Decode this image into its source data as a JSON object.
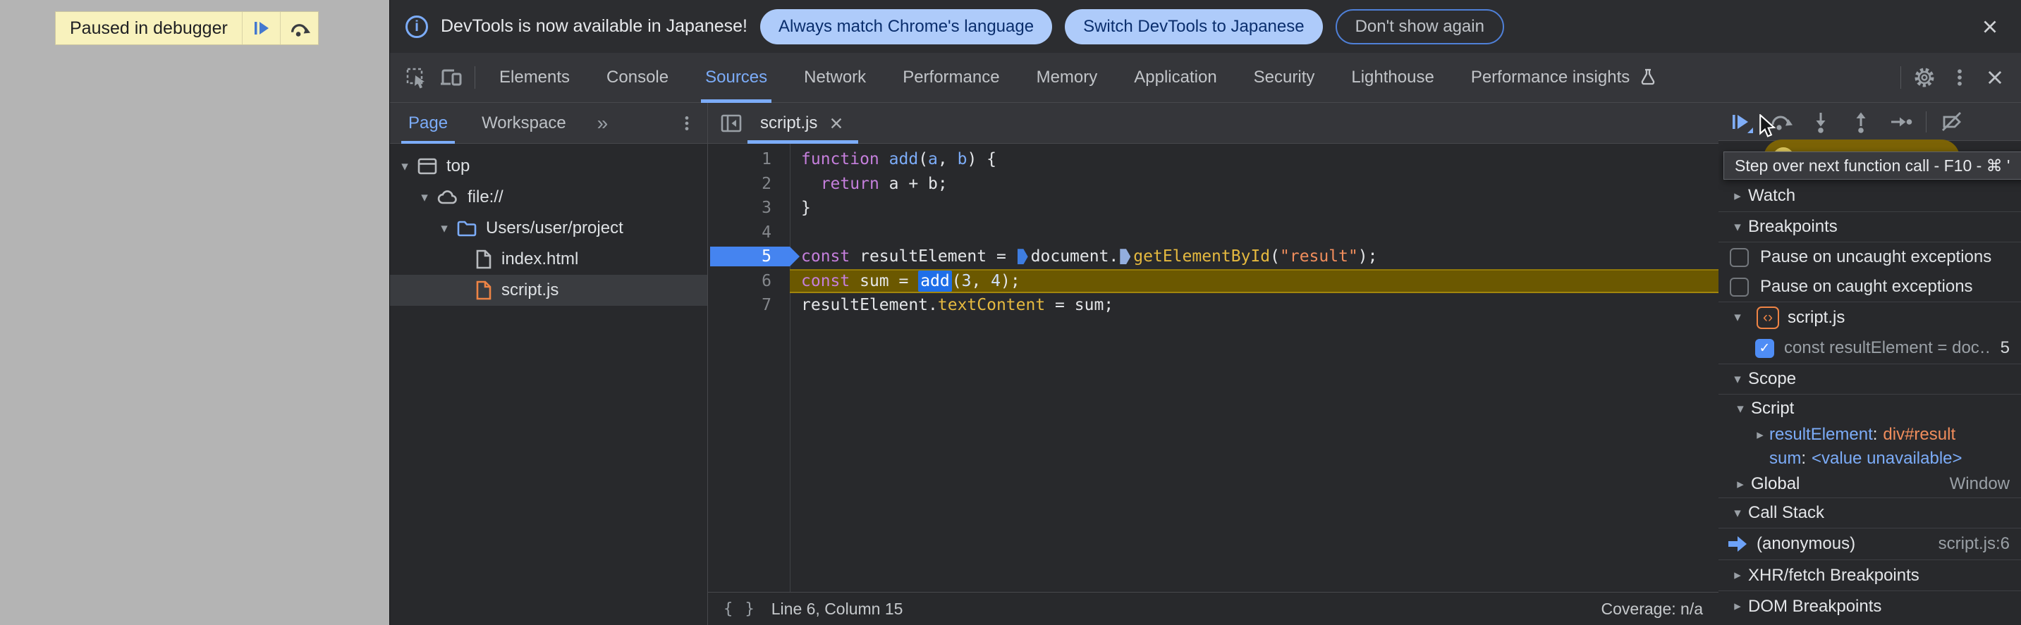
{
  "overlay": {
    "paused_text": "Paused in debugger"
  },
  "infobar": {
    "message": "DevTools is now available in Japanese!",
    "btn_match": "Always match Chrome's language",
    "btn_switch": "Switch DevTools to Japanese",
    "btn_dismiss": "Don't show again"
  },
  "tabs": {
    "items": [
      "Elements",
      "Console",
      "Sources",
      "Network",
      "Performance",
      "Memory",
      "Application",
      "Security",
      "Lighthouse",
      "Performance insights"
    ],
    "active": "Sources"
  },
  "sidebar": {
    "tab_page": "Page",
    "tab_workspace": "Workspace",
    "more_tabs": "»",
    "tree": {
      "top": "top",
      "file_scheme": "file://",
      "project": "Users/user/project",
      "index": "index.html",
      "script": "script.js"
    }
  },
  "editor": {
    "file_tab": "script.js",
    "status_line": "Line 6, Column 15",
    "coverage": "Coverage: n/a",
    "brace_icon": "{ }",
    "code": {
      "lines": [
        {
          "n": "1",
          "t": [
            [
              "kw",
              "function"
            ],
            [
              "pl",
              " "
            ],
            [
              "fn",
              "add"
            ],
            [
              "pl",
              "("
            ],
            [
              "pr",
              "a"
            ],
            [
              "pl",
              ", "
            ],
            [
              "pr",
              "b"
            ],
            [
              "pl",
              ") {"
            ]
          ]
        },
        {
          "n": "2",
          "t": [
            [
              "pl",
              "  "
            ],
            [
              "kw",
              "return"
            ],
            [
              "pl",
              " a + b;"
            ]
          ]
        },
        {
          "n": "3",
          "t": [
            [
              "pl",
              "}"
            ]
          ]
        },
        {
          "n": "4",
          "t": []
        },
        {
          "n": "5",
          "exec": true,
          "t": [
            [
              "kw",
              "const"
            ],
            [
              "pl",
              " resultElement = "
            ],
            [
              "m1",
              ""
            ],
            [
              "pl",
              "document."
            ],
            [
              "m2",
              ""
            ],
            [
              "prop",
              "getElementById"
            ],
            [
              "pl",
              "("
            ],
            [
              "str",
              "\"result\""
            ],
            [
              "pl",
              ");"
            ]
          ]
        },
        {
          "n": "6",
          "hl": true,
          "t": [
            [
              "kw",
              "const"
            ],
            [
              "pl",
              " sum = "
            ],
            [
              "sel",
              "add"
            ],
            [
              "pl",
              "("
            ],
            [
              "num",
              "3"
            ],
            [
              "pl",
              ", "
            ],
            [
              "num",
              "4"
            ],
            [
              "pl",
              ");"
            ]
          ]
        },
        {
          "n": "7",
          "t": [
            [
              "pl",
              "resultElement."
            ],
            [
              "prop",
              "textContent"
            ],
            [
              "pl",
              " = sum;"
            ]
          ]
        }
      ]
    }
  },
  "debugger": {
    "tooltip": "Step over next function call - F10 - ⌘ '",
    "watch": "Watch",
    "breakpoints": "Breakpoints",
    "cb_uncaught": "Pause on uncaught exceptions",
    "cb_caught": "Pause on caught exceptions",
    "bp_file": "script.js",
    "bp_entry": {
      "text": "const resultElement = doc…",
      "line": "5"
    },
    "scope": "Scope",
    "scope_script": "Script",
    "var1": {
      "name": "resultElement",
      "value": "div#result"
    },
    "var2": {
      "name": "sum",
      "value": "<value unavailable>"
    },
    "global": {
      "name": "Global",
      "value": "Window"
    },
    "callstack": "Call Stack",
    "frame": {
      "name": "(anonymous)",
      "location": "script.js:6"
    },
    "xhr": "XHR/fetch Breakpoints",
    "dom": "DOM Breakpoints"
  },
  "colors": {
    "accent_blue": "#7cacf8",
    "paused_line_bg": "#6b5800",
    "selection_blue": "#1f6fe8",
    "infobar_button_bg": "#aecbfa",
    "paused_banner_bg": "#f8f2bd",
    "gold_pill": "#7c6306",
    "breakpoint_flag": "#4584f0"
  },
  "glyphs": {
    "check": "✓",
    "kebab": "⋮",
    "twisty_open": "▾",
    "twisty_closed": "▸"
  }
}
